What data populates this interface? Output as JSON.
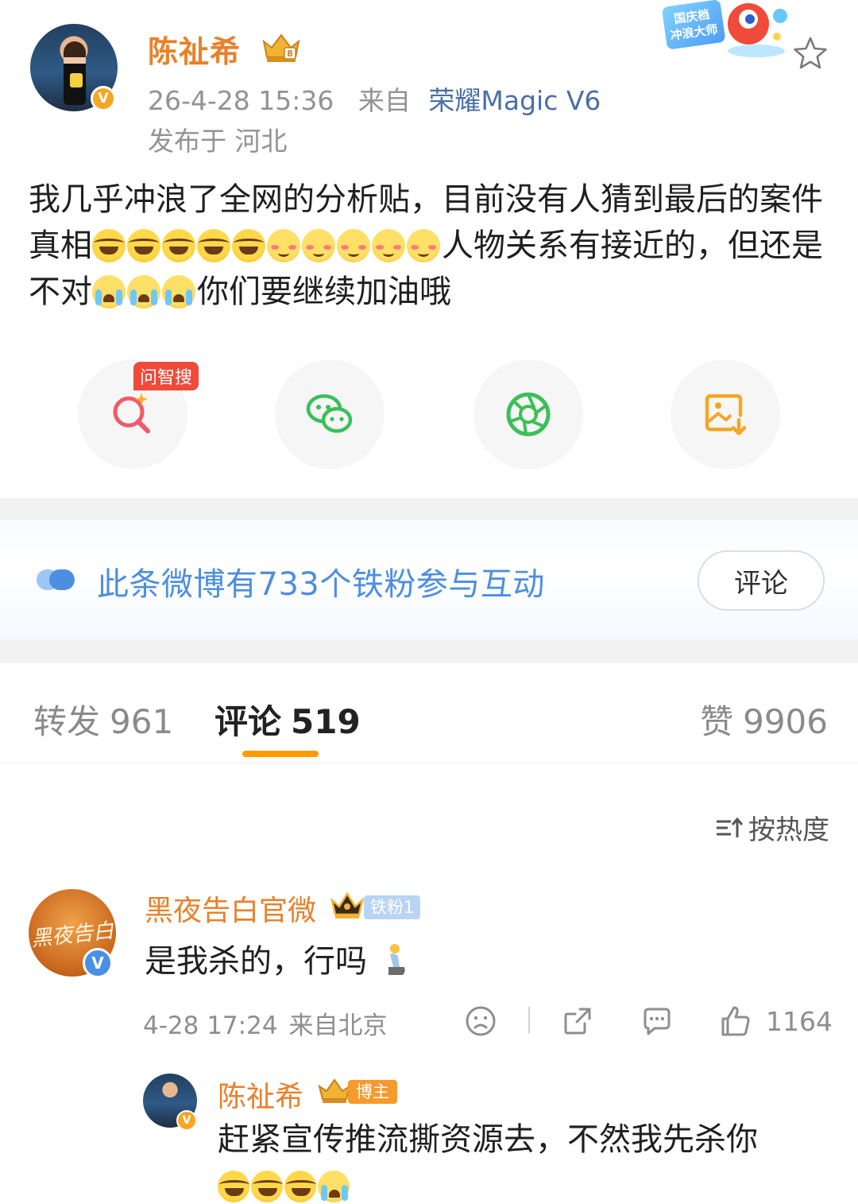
{
  "post": {
    "author": "陈祉希",
    "date": "26-4-28 15:36",
    "source_label": "来自",
    "source_device": "荣耀Magic V6",
    "location": "发布于 河北",
    "campaign_badge": "国庆档冲浪大师",
    "text_1": "我几乎冲浪了全网的分析贴，目前没有人猜到最后的案件真相",
    "text_2": "人物关系有接近的，但还是不对",
    "text_3": "你们要继续加油哦",
    "emoji_row_1": [
      "laugh-cry",
      "laugh-cry",
      "laugh-cry",
      "laugh-cry",
      "laugh-cry",
      "blush",
      "blush",
      "blush",
      "blush",
      "blush"
    ],
    "emoji_row_2": [
      "cry",
      "cry",
      "cry"
    ]
  },
  "share": {
    "ai_tag": "问智搜",
    "buttons": [
      "ai-search-icon",
      "wechat-icon",
      "moments-icon",
      "save-image-icon"
    ],
    "colors": {
      "ai": "#f05a4a",
      "wechat": "#3cbf59",
      "moments": "#3cbf59",
      "save": "#f5a623"
    }
  },
  "fan_strip": {
    "text": "此条微博有733个铁粉参与互动",
    "button": "评论"
  },
  "tabs": {
    "repost_label": "转发",
    "repost_count": "961",
    "comments_label": "评论",
    "comments_count": "519",
    "likes_label": "赞",
    "likes_count": "9906"
  },
  "sort": {
    "label": "按热度"
  },
  "comment": {
    "avatar_text": "黑夜告白",
    "name": "黑夜告白官微",
    "fan_badge": "铁粉1",
    "text": "是我杀的，行吗",
    "time": "4-28 17:24",
    "source": "来自北京",
    "likes": "1164"
  },
  "reply": {
    "name": "陈祉希",
    "badge": "博主",
    "text": "赶紧宣传推流撕资源去，不然我先杀你",
    "emojis": [
      "laugh-cry",
      "laugh-cry",
      "laugh-cry",
      "cry"
    ]
  },
  "colors": {
    "accent_orange": "#e8812a",
    "link_blue": "#4a6ea8",
    "fan_blue": "#4d8ee0",
    "tab_underline": "#ff9a00"
  }
}
